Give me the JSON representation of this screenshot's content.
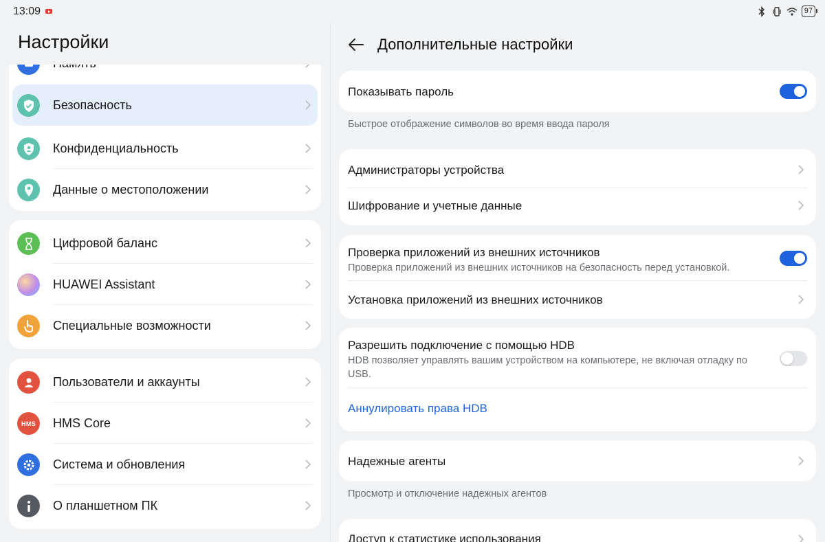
{
  "status": {
    "time": "13:09",
    "battery": "97"
  },
  "left": {
    "title": "Настройки",
    "partial_item": "Память",
    "group1": [
      {
        "label": "Безопасность",
        "icon": "shield-icon",
        "color": "#5ec3ae",
        "active": true
      },
      {
        "label": "Конфиденциальность",
        "icon": "privacy-icon",
        "color": "#5ec3ae"
      },
      {
        "label": "Данные о местоположении",
        "icon": "location-icon",
        "color": "#5ec3ae"
      }
    ],
    "group2": [
      {
        "label": "Цифровой баланс",
        "icon": "hourglass-icon",
        "color": "#5bbf55"
      },
      {
        "label": "HUAWEI Assistant",
        "icon": "assistant-icon",
        "color": "#c08ee8"
      },
      {
        "label": "Специальные возможности",
        "icon": "hand-icon",
        "color": "#f2a23a"
      }
    ],
    "group3": [
      {
        "label": "Пользователи и аккаунты",
        "icon": "user-icon",
        "color": "#e2533f"
      },
      {
        "label": "HMS Core",
        "icon": "hms-icon",
        "color": "#e2533f",
        "badge": "HMS"
      },
      {
        "label": "Система и обновления",
        "icon": "gear-icon",
        "color": "#2f6fe0"
      },
      {
        "label": "О планшетном ПК",
        "icon": "info-icon",
        "color": "#555a60"
      }
    ]
  },
  "right": {
    "title": "Дополнительные настройки",
    "show_password": {
      "title": "Показывать пароль",
      "caption": "Быстрое отображение символов во время ввода пароля",
      "enabled": true
    },
    "device_admins": "Администраторы устройства",
    "encryption": "Шифрование и учетные данные",
    "external_check": {
      "title": "Проверка приложений из внешних источников",
      "subtitle": "Проверка приложений из внешних источников на безопасность перед установкой.",
      "enabled": true
    },
    "external_install": "Установка приложений из внешних источников",
    "hdb": {
      "title": "Разрешить подключение с помощью HDB",
      "subtitle": "HDB позволяет управлять вашим устройством на компьютере, не включая отладку по USB.",
      "enabled": false,
      "revoke": "Аннулировать права HDB"
    },
    "trust_agents": {
      "title": "Надежные агенты",
      "caption": "Просмотр и отключение надежных агентов"
    },
    "usage_access": "Доступ к статистике использования"
  },
  "colors": {
    "accent": "#1f62dd",
    "active_bg": "#e5eefb",
    "background": "#f1f3f5"
  }
}
